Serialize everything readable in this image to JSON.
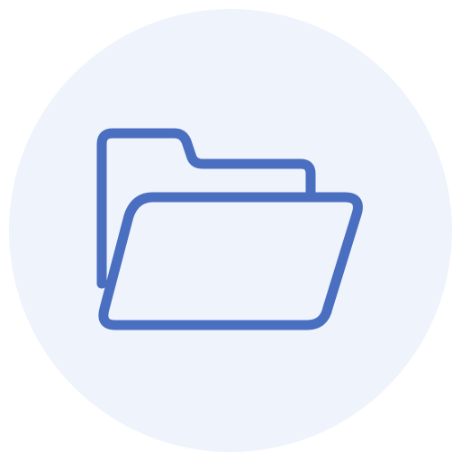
{
  "icon": {
    "name": "open-folder-icon",
    "background_color": "#EEF3FC",
    "stroke_color": "#4A6FC0"
  }
}
